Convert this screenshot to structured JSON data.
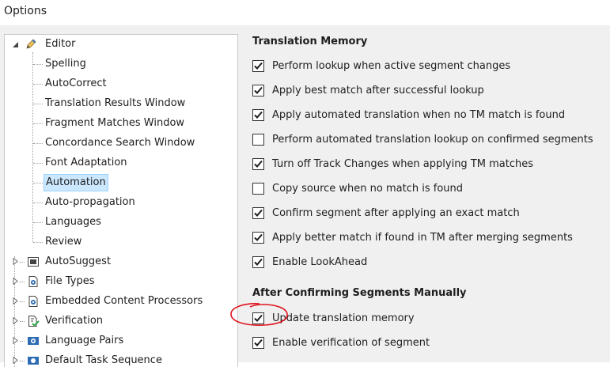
{
  "window": {
    "title": "Options"
  },
  "tree": {
    "editor": {
      "label": "Editor",
      "icon": "pencil-icon"
    },
    "editor_children": [
      {
        "label": "Spelling"
      },
      {
        "label": "AutoCorrect"
      },
      {
        "label": "Translation Results Window"
      },
      {
        "label": "Fragment Matches Window"
      },
      {
        "label": "Concordance Search Window"
      },
      {
        "label": "Font Adaptation"
      },
      {
        "label": "Automation",
        "selected": true
      },
      {
        "label": "Auto-propagation"
      },
      {
        "label": "Languages"
      },
      {
        "label": "Review"
      }
    ],
    "roots": [
      {
        "label": "AutoSuggest",
        "icon": "autosuggest-icon"
      },
      {
        "label": "File Types",
        "icon": "file-types-icon"
      },
      {
        "label": "Embedded Content Processors",
        "icon": "embedded-content-icon"
      },
      {
        "label": "Verification",
        "icon": "verification-icon"
      },
      {
        "label": "Language Pairs",
        "icon": "language-pairs-icon"
      },
      {
        "label": "Default Task Sequence",
        "icon": "task-sequence-icon"
      }
    ]
  },
  "translation_memory": {
    "title": "Translation Memory",
    "options": [
      {
        "label": "Perform lookup when active segment changes",
        "checked": true
      },
      {
        "label": "Apply best match after successful lookup",
        "checked": true
      },
      {
        "label": "Apply automated translation when no TM match is found",
        "checked": true
      },
      {
        "label": "Perform automated translation lookup on confirmed segments",
        "checked": false
      },
      {
        "label": "Turn off Track Changes when applying TM matches",
        "checked": true
      },
      {
        "label": "Copy source when no match is found",
        "checked": false
      },
      {
        "label": "Confirm segment after applying an exact match",
        "checked": true
      },
      {
        "label": "Apply better match if found in TM after merging segments",
        "checked": true
      },
      {
        "label": "Enable LookAhead",
        "checked": true
      }
    ]
  },
  "after_confirming": {
    "title": "After Confirming Segments Manually",
    "options": [
      {
        "label": "Update translation memory",
        "checked": true
      },
      {
        "label": "Enable verification of segment",
        "checked": true
      }
    ]
  },
  "colors": {
    "selection_fill": "#cce8ff",
    "selection_border": "#99d1ff",
    "annotation_red": "#e0141e",
    "icon_blue": "#2e6db4"
  }
}
